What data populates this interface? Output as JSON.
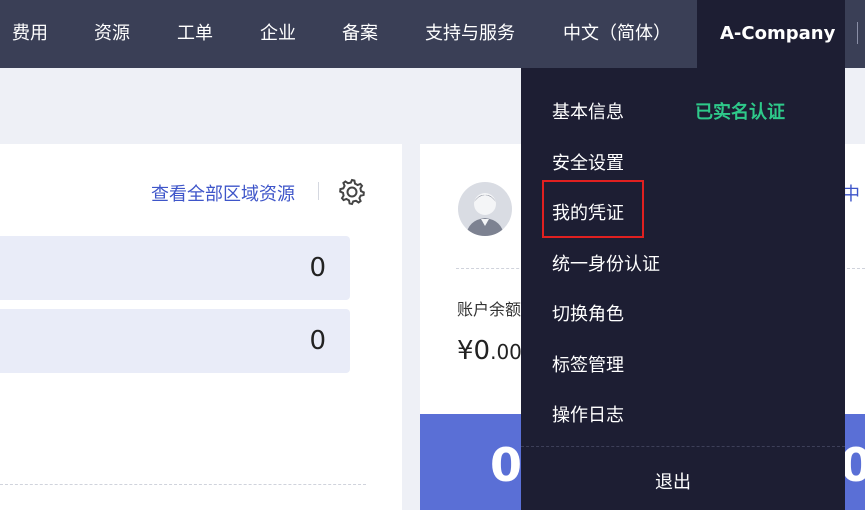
{
  "nav": {
    "items": [
      "费用",
      "资源",
      "工单",
      "企业",
      "备案",
      "支持与服务",
      "中文（简体）"
    ],
    "account": "A-Company"
  },
  "resources": {
    "view_all": "查看全部区域资源",
    "stats": [
      "0",
      "0"
    ]
  },
  "account_card": {
    "balance_label": "账户余额",
    "balance_value": "¥0",
    "balance_decimal": ".00",
    "blue_value": "0",
    "blue_value_right": "0",
    "peek_text": "中"
  },
  "account_menu": {
    "items": [
      "基本信息",
      "安全设置",
      "我的凭证",
      "统一身份认证",
      "切换角色",
      "标签管理",
      "操作日志"
    ],
    "verified_badge": "已实名认证",
    "highlighted_item": "我的凭证",
    "logout": "退出"
  },
  "colors": {
    "topbar": "#3a3f56",
    "dropdown": "#1d1e33",
    "verified": "#2ec98a",
    "link": "#3e55c9",
    "highlight": "#e02020",
    "blue_panel": "#5a6fd6"
  },
  "icons": [
    "gear-icon",
    "avatar-icon"
  ]
}
